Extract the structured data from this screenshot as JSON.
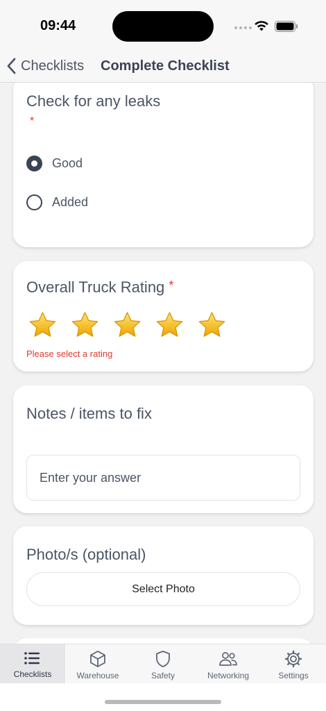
{
  "status": {
    "time": "09:44"
  },
  "nav": {
    "back_label": "Checklists",
    "title": "Complete Checklist"
  },
  "cards": {
    "leaks": {
      "title": "Check for any leaks",
      "required_mark": "*",
      "options": [
        {
          "label": "Good",
          "selected": true
        },
        {
          "label": "Added",
          "selected": false
        }
      ]
    },
    "rating": {
      "title": "Overall Truck Rating",
      "required_mark": "*",
      "star_count": 5,
      "error": "Please select a rating"
    },
    "notes": {
      "title": "Notes / items to fix",
      "placeholder": "Enter your answer"
    },
    "photos": {
      "title": "Photo/s (optional)",
      "button_label": "Select Photo"
    }
  },
  "tabs": [
    {
      "label": "Checklists",
      "icon": "list-icon",
      "active": true
    },
    {
      "label": "Warehouse",
      "icon": "cube-icon",
      "active": false
    },
    {
      "label": "Safety",
      "icon": "shield-icon",
      "active": false
    },
    {
      "label": "Networking",
      "icon": "people-icon",
      "active": false
    },
    {
      "label": "Settings",
      "icon": "gear-icon",
      "active": false
    }
  ],
  "colors": {
    "accent": "#3a4454",
    "error": "#dc3b30",
    "star": "#f5b800"
  }
}
